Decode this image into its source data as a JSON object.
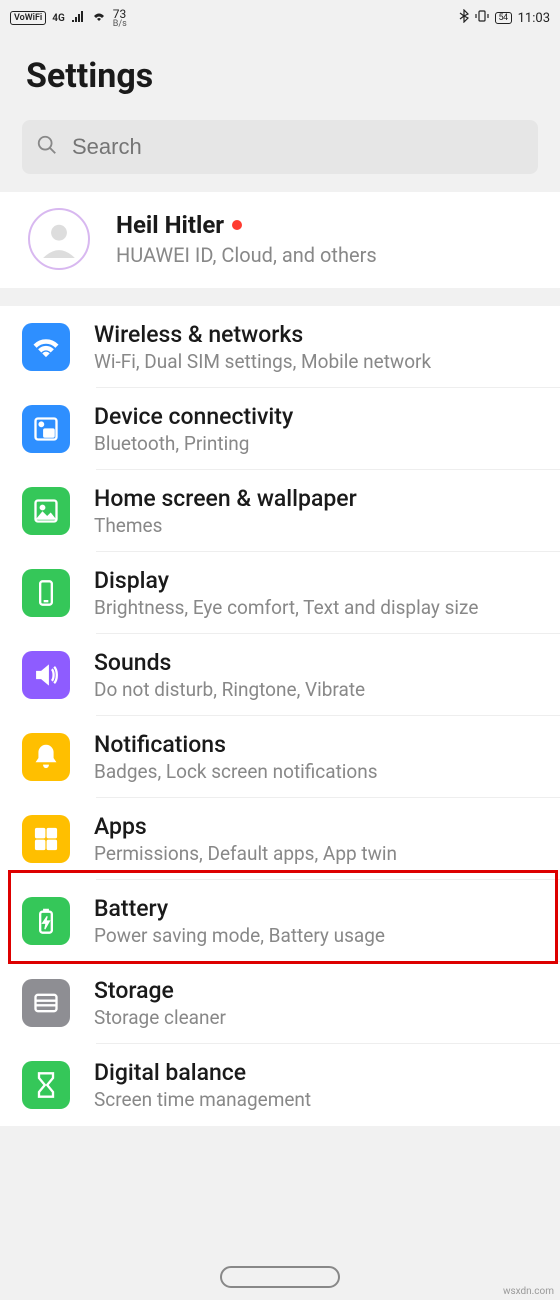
{
  "status_bar": {
    "vowifi": "VoWiFi",
    "net_gen": "4G",
    "speed_value": "73",
    "speed_unit": "B/s",
    "battery": "54",
    "time": "11:03"
  },
  "title": "Settings",
  "search": {
    "placeholder": "Search"
  },
  "account": {
    "name": "Heil Hitler",
    "subtitle": "HUAWEI ID, Cloud, and others"
  },
  "items": [
    {
      "icon": "wifi-icon",
      "color": "#2e8fff",
      "title": "Wireless & networks",
      "sub": "Wi-Fi, Dual SIM settings, Mobile network"
    },
    {
      "icon": "connectivity-icon",
      "color": "#2e8fff",
      "title": "Device connectivity",
      "sub": "Bluetooth, Printing"
    },
    {
      "icon": "wallpaper-icon",
      "color": "#35c759",
      "title": "Home screen & wallpaper",
      "sub": "Themes"
    },
    {
      "icon": "display-icon",
      "color": "#35c759",
      "title": "Display",
      "sub": "Brightness, Eye comfort, Text and display size"
    },
    {
      "icon": "sound-icon",
      "color": "#8e5cff",
      "title": "Sounds",
      "sub": "Do not disturb, Ringtone, Vibrate"
    },
    {
      "icon": "bell-icon",
      "color": "#ffbf00",
      "title": "Notifications",
      "sub": "Badges, Lock screen notifications"
    },
    {
      "icon": "apps-icon",
      "color": "#ffbf00",
      "title": "Apps",
      "sub": "Permissions, Default apps, App twin"
    },
    {
      "icon": "battery-icon",
      "color": "#35c759",
      "title": "Battery",
      "sub": "Power saving mode, Battery usage"
    },
    {
      "icon": "storage-icon",
      "color": "#8e8e93",
      "title": "Storage",
      "sub": "Storage cleaner"
    },
    {
      "icon": "hourglass-icon",
      "color": "#35c759",
      "title": "Digital balance",
      "sub": "Screen time management"
    }
  ],
  "highlight_index": 6,
  "attribution": "wsxdn.com"
}
